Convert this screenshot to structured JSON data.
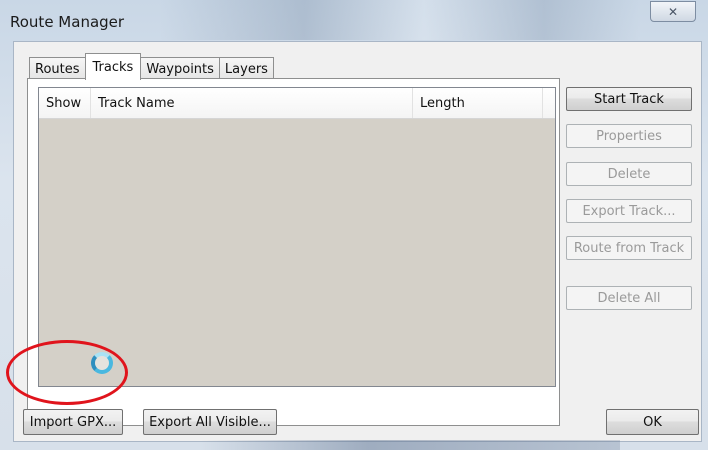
{
  "window": {
    "title": "Route Manager",
    "close_glyph": "✕"
  },
  "tabs": [
    {
      "label": "Routes",
      "active": false
    },
    {
      "label": "Tracks",
      "active": true
    },
    {
      "label": "Waypoints",
      "active": false
    },
    {
      "label": "Layers",
      "active": false
    }
  ],
  "track_list": {
    "columns": [
      "Show",
      "Track Name",
      "Length"
    ],
    "rows": []
  },
  "side_buttons": {
    "start_track": "Start Track",
    "properties": "Properties",
    "delete": "Delete",
    "export_track": "Export Track...",
    "route_from_track": "Route from Track",
    "delete_all": "Delete All"
  },
  "footer": {
    "import_gpx": "Import GPX...",
    "export_all_visible": "Export All Visible...",
    "ok": "OK"
  },
  "icons": {
    "close": "close-icon",
    "busy": "busy-cursor-icon"
  },
  "colors": {
    "highlight_ring": "#e0141c",
    "list_background": "#d4d0c8"
  }
}
